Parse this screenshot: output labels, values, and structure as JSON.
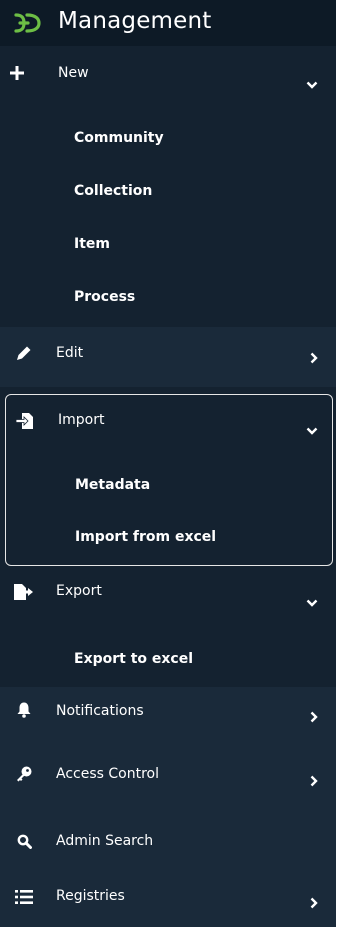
{
  "header": {
    "title": "Management",
    "logo_icon": "dspace-logo-icon",
    "accent": "#6dbe45"
  },
  "colors": {
    "background": "#142230",
    "row_alt": "#1a2a3a",
    "header": "#0d1a26",
    "text": "#ffffff"
  },
  "menu": {
    "new": {
      "label": "New",
      "icon": "plus-icon",
      "expanded": true,
      "children": [
        "Community",
        "Collection",
        "Item",
        "Process"
      ]
    },
    "edit": {
      "label": "Edit",
      "icon": "pencil-icon",
      "expanded": false
    },
    "import": {
      "label": "Import",
      "icon": "file-import-icon",
      "expanded": true,
      "children": [
        "Metadata",
        "Import from excel"
      ]
    },
    "export": {
      "label": "Export",
      "icon": "file-export-icon",
      "expanded": true,
      "children": [
        "Export to excel"
      ]
    },
    "notifications": {
      "label": "Notifications",
      "icon": "bell-icon",
      "expanded": false
    },
    "access_control": {
      "label": "Access Control",
      "icon": "key-icon",
      "expanded": false
    },
    "admin_search": {
      "label": "Admin Search",
      "icon": "search-icon"
    },
    "registries": {
      "label": "Registries",
      "icon": "list-icon",
      "expanded": false
    }
  }
}
